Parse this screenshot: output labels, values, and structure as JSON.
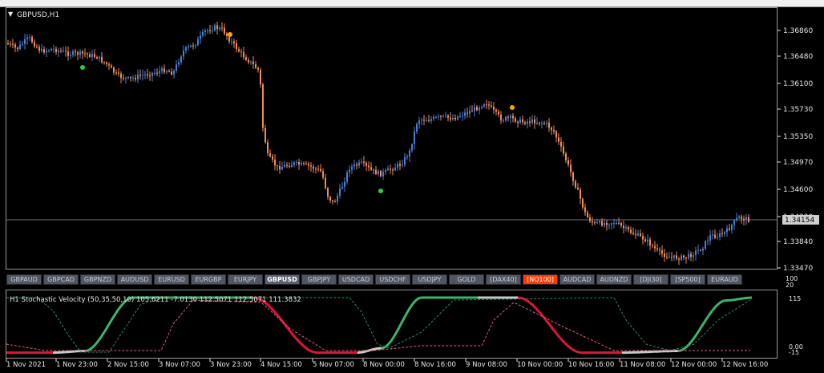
{
  "window": {
    "title": "GBPUSD,H1",
    "collapse_icon": "triangle-down-icon"
  },
  "price_axis": {
    "labels": [
      "1.36860",
      "1.36480",
      "1.36100",
      "1.35730",
      "1.35350",
      "1.34970",
      "1.34600",
      "1.34220",
      "1.33840",
      "1.33470"
    ],
    "current_price": "1.34154"
  },
  "time_axis": {
    "labels": [
      "1 Nov 2021",
      "1 Nov 23:00",
      "2 Nov 15:00",
      "3 Nov 07:00",
      "3 Nov 23:00",
      "4 Nov 15:00",
      "5 Nov 07:00",
      "8 Nov 00:00",
      "8 Nov 16:00",
      "9 Nov 08:00",
      "10 Nov 00:00",
      "10 Nov 16:00",
      "11 Nov 08:00",
      "12 Nov 00:00",
      "12 Nov 16:00"
    ]
  },
  "symbol_bar": {
    "buttons": [
      "GBPAUD",
      "GBPCAD",
      "GBPNZD",
      "AUDUSD",
      "EURUSD",
      "EURGBP",
      "EURJPY",
      "GBPUSD",
      "GBPJPY",
      "USDCAD",
      "USDCHF",
      "USDJPY",
      "GOLD",
      "[DAX40]",
      "[NQ100]",
      "AUDCAD",
      "AUDNZD",
      "[DJI30]",
      "[SP500]",
      "EURAUD"
    ],
    "active": "GBPUSD",
    "highlight": "[NQ100]",
    "highlight_color": "#ff3a00"
  },
  "indicator": {
    "header": "H1   Stochastic Velocity (50,35,50,10) 105.6211 -7.0130 112.5071 112.5071 111.3832",
    "scale_top": [
      "100",
      "20"
    ],
    "scale_labels": [
      "115",
      "0.00",
      "-15"
    ]
  },
  "colors": {
    "bull_candle": "#4a7fd4",
    "bear_candle": "#f08c5a",
    "up_line": "#3cb371",
    "down_line": "#dc143c",
    "neutral_line": "#c8c8c8",
    "arrow_up": "#2ecc40",
    "arrow_down": "#ffa500"
  }
}
